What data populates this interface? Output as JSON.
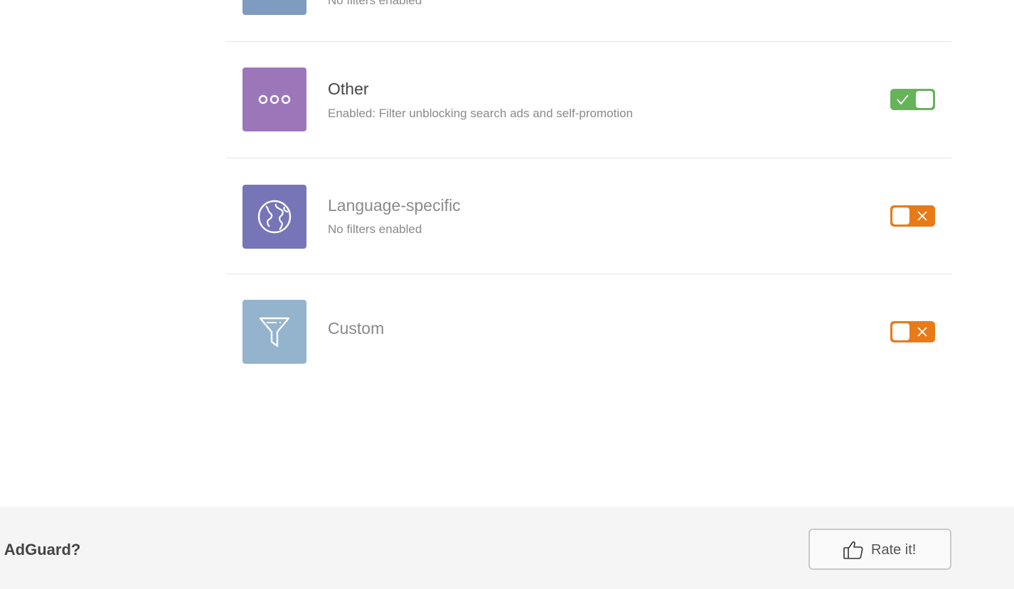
{
  "colors": {
    "toggle_on": "#67b35a",
    "toggle_off": "#e87a17",
    "tile_top": "#7f9bbf",
    "tile_other": "#9b77ba",
    "tile_language": "#7575b8",
    "tile_custom": "#94b3cd"
  },
  "filters": {
    "top_partial": {
      "subtitle": "No filters enabled"
    },
    "other": {
      "icon": "dots-icon",
      "title": "Other",
      "subtitle": "Enabled: Filter unblocking search ads and self-promotion",
      "enabled": true
    },
    "language": {
      "icon": "globe-icon",
      "title": "Language-specific",
      "subtitle": "No filters enabled",
      "enabled": false
    },
    "custom": {
      "icon": "funnel-icon",
      "title": "Custom",
      "enabled": false
    }
  },
  "footer": {
    "question": "ke AdGuard?",
    "rate_button": {
      "icon": "thumbs-up-icon",
      "label": "Rate it!"
    }
  }
}
